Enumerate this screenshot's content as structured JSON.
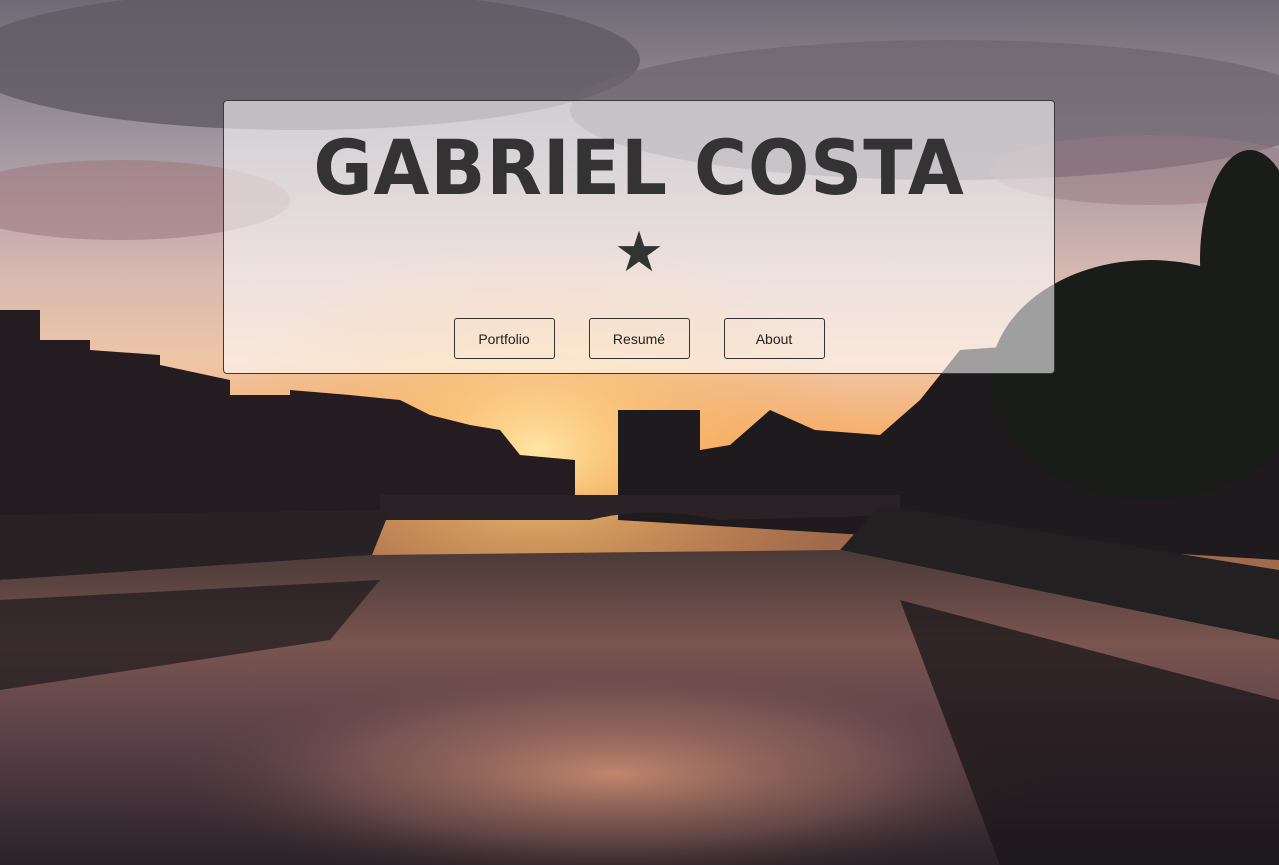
{
  "hero": {
    "title": "Gabriel Costa",
    "star": "★",
    "background": "sunset-over-river-city-photo"
  },
  "nav": {
    "buttons": [
      {
        "label": "Portfolio"
      },
      {
        "label": "Resumé"
      },
      {
        "label": "About"
      }
    ]
  },
  "colors": {
    "text": "#333333",
    "card_bg": "rgba(255,255,255,0.58)",
    "border": "#333333"
  }
}
